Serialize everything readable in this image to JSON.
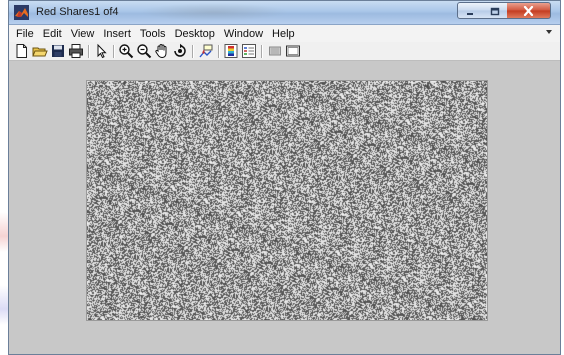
{
  "window": {
    "title": "Red Shares1 of4"
  },
  "menu": {
    "items": [
      "File",
      "Edit",
      "View",
      "Insert",
      "Tools",
      "Desktop",
      "Window",
      "Help"
    ]
  },
  "toolbar": {
    "buttons": [
      {
        "icon": "new-figure-icon"
      },
      {
        "icon": "open-file-icon"
      },
      {
        "icon": "save-figure-icon"
      },
      {
        "icon": "print-figure-icon"
      },
      {
        "icon": "edit-plot-arrow-icon"
      },
      {
        "icon": "zoom-in-icon"
      },
      {
        "icon": "zoom-out-icon"
      },
      {
        "icon": "pan-hand-icon"
      },
      {
        "icon": "rotate-3d-icon"
      },
      {
        "icon": "data-cursor-icon"
      },
      {
        "icon": "insert-colorbar-icon"
      },
      {
        "icon": "insert-legend-icon"
      },
      {
        "icon": "hide-plot-tools-icon"
      },
      {
        "icon": "show-plot-tools-icon"
      }
    ]
  },
  "colors": {
    "figure_background": "#c8c8c8",
    "noise_light": "#e6e6e6",
    "noise_dark": "#555555"
  }
}
